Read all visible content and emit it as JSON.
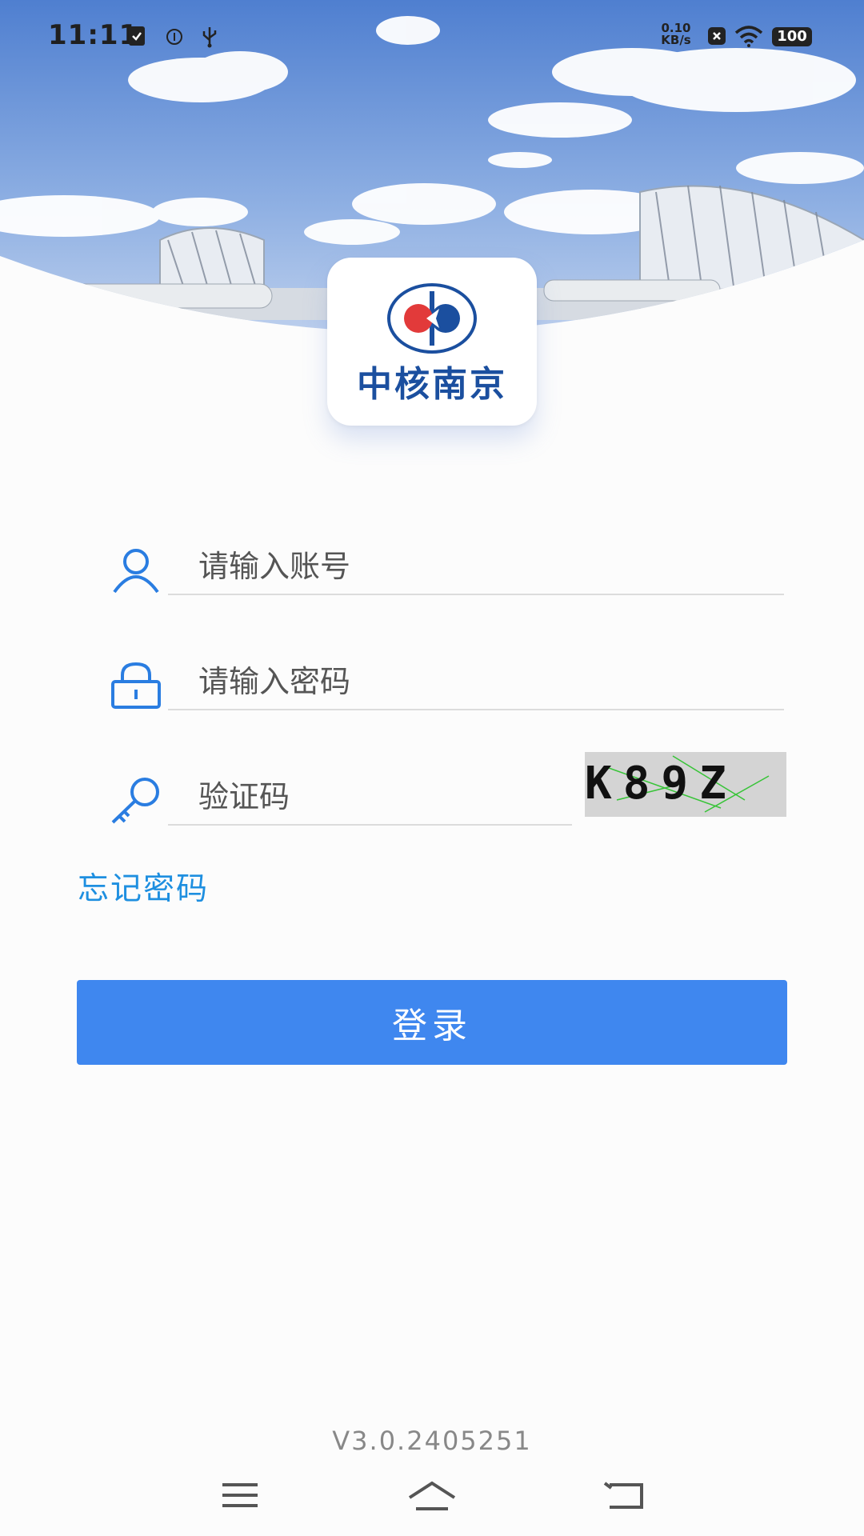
{
  "status_bar": {
    "time": "11:11",
    "net_speed_value": "0.10",
    "net_speed_unit": "KB/s",
    "battery": "100"
  },
  "logo": {
    "text": "中核南京"
  },
  "form": {
    "account_placeholder": "请输入账号",
    "password_placeholder": "请输入密码",
    "captcha_placeholder": "验证码",
    "captcha_text": "K89Z",
    "forgot_password": "忘记密码",
    "login_button": "登录"
  },
  "footer": {
    "version": "V3.0.2405251"
  },
  "colors": {
    "primary": "#3f87ef",
    "link": "#1e8fe0",
    "icon": "#2a7de1",
    "logo_blue": "#1b4f9f",
    "logo_red": "#e23a3a"
  },
  "icons": {
    "account": "user-icon",
    "password": "lock-icon",
    "captcha": "key-icon",
    "nav_menu": "menu-icon",
    "nav_home": "home-icon",
    "nav_back": "back-icon"
  }
}
